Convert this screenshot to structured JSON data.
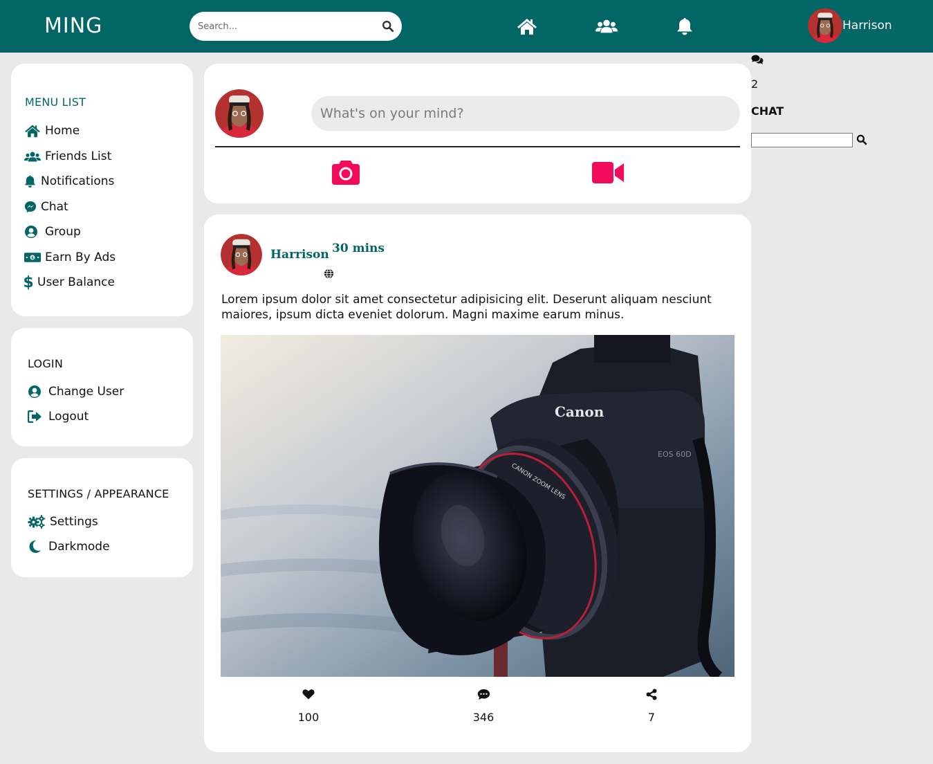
{
  "header": {
    "brand": "MING",
    "search_placeholder": "Search...",
    "icons": [
      "home-icon",
      "friends-icon",
      "bell-icon"
    ],
    "user_name": "Harrison"
  },
  "colors": {
    "brand_teal": "#036666",
    "accent_pink": "#f20a5b",
    "background": "#e9e9e9"
  },
  "sidebar": {
    "menu": {
      "title": "MENU LIST",
      "items": [
        {
          "label": "Home",
          "icon": "home-icon"
        },
        {
          "label": "Friends List",
          "icon": "friends-icon"
        },
        {
          "label": "Notifications",
          "icon": "bell-icon"
        },
        {
          "label": "Chat",
          "icon": "messenger-icon"
        },
        {
          "label": "Group",
          "icon": "user-circle-icon"
        },
        {
          "label": "Earn By Ads",
          "icon": "money-bill-icon"
        },
        {
          "label": "User Balance",
          "icon": "dollar-icon"
        }
      ]
    },
    "login": {
      "title": "LOGIN",
      "items": [
        {
          "label": "Change User",
          "icon": "user-circle-icon"
        },
        {
          "label": "Logout",
          "icon": "logout-icon"
        }
      ]
    },
    "settings": {
      "title": "SETTINGS / APPEARANCE",
      "items": [
        {
          "label": "Settings",
          "icon": "gears-icon"
        },
        {
          "label": "Darkmode",
          "icon": "moon-icon"
        }
      ]
    }
  },
  "composer": {
    "placeholder": "What's on your mind?",
    "actions": [
      "camera-icon",
      "video-icon"
    ]
  },
  "post": {
    "author": "Harrison",
    "time": "30 mins",
    "visibility_icon": "globe-icon",
    "text": "Lorem ipsum dolor sit amet consectetur adipisicing elit. Deserunt aliquam nesciunt maiores, ipsum dicta eveniet dolorum. Magni maxime earum minus.",
    "image_subject": "Canon EOS 60D camera with zoom lens on tripod",
    "camera_brand_text": "Canon",
    "camera_model_text": "EOS 60D",
    "lens_ring_text": "CANON ZOOM LENS",
    "stats": {
      "likes": "100",
      "comments": "346",
      "shares": "7"
    }
  },
  "chat": {
    "icon": "comments-icon",
    "count": "2",
    "title": "CHAT"
  }
}
